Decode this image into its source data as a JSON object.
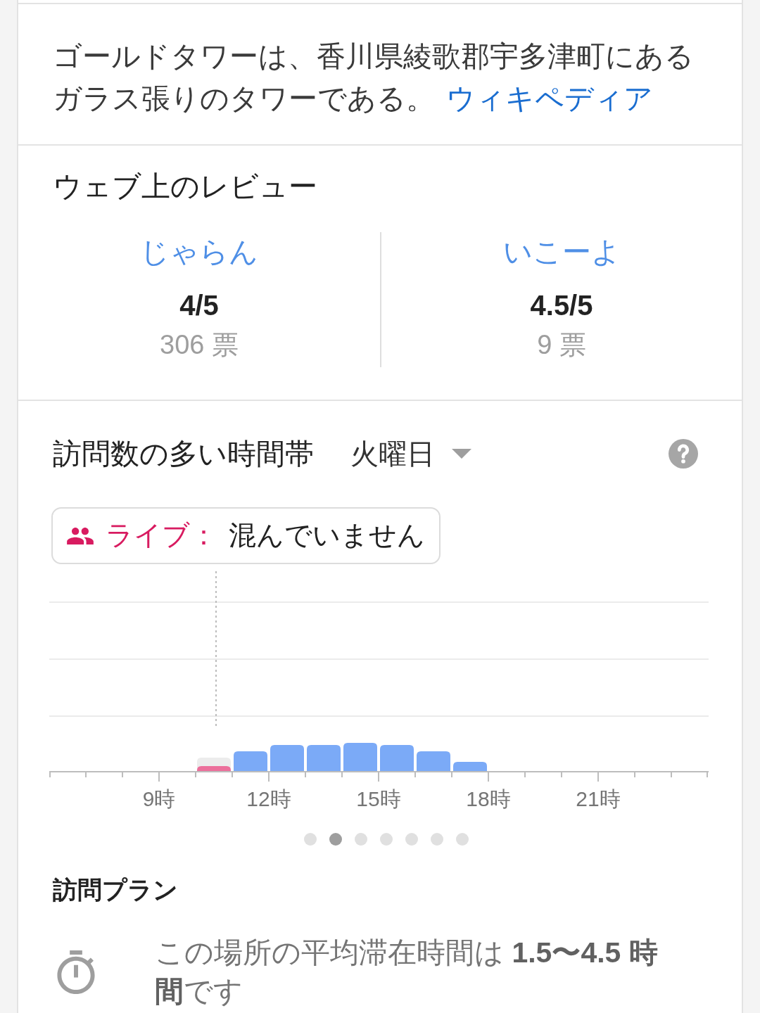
{
  "description": {
    "text": "ゴールドタワーは、香川県綾歌郡宇多津町にあるガラス張りのタワーである。",
    "link": "ウィキペディア"
  },
  "reviews": {
    "title": "ウェブ上のレビュー",
    "sources": [
      {
        "name": "じゃらん",
        "rating": "4/5",
        "votes": "306 票"
      },
      {
        "name": "いこーよ",
        "rating": "4.5/5",
        "votes": "9 票"
      }
    ]
  },
  "popular_times": {
    "title": "訪問数の多い時間帯",
    "day": "火曜日",
    "live": {
      "label": "ライブ：",
      "status": "混んでいません"
    },
    "chart": {
      "hour_labels": [
        "9時",
        "12時",
        "15時",
        "18時",
        "21時"
      ]
    },
    "pages": [
      {
        "selected": false
      },
      {
        "selected": true
      },
      {
        "selected": false
      },
      {
        "selected": false
      },
      {
        "selected": false
      },
      {
        "selected": false
      },
      {
        "selected": false
      }
    ]
  },
  "visit_plan": {
    "title": "訪問プラン",
    "duration": "この場所の平均滞在時間は **1.5〜4.5 時間**です"
  }
}
